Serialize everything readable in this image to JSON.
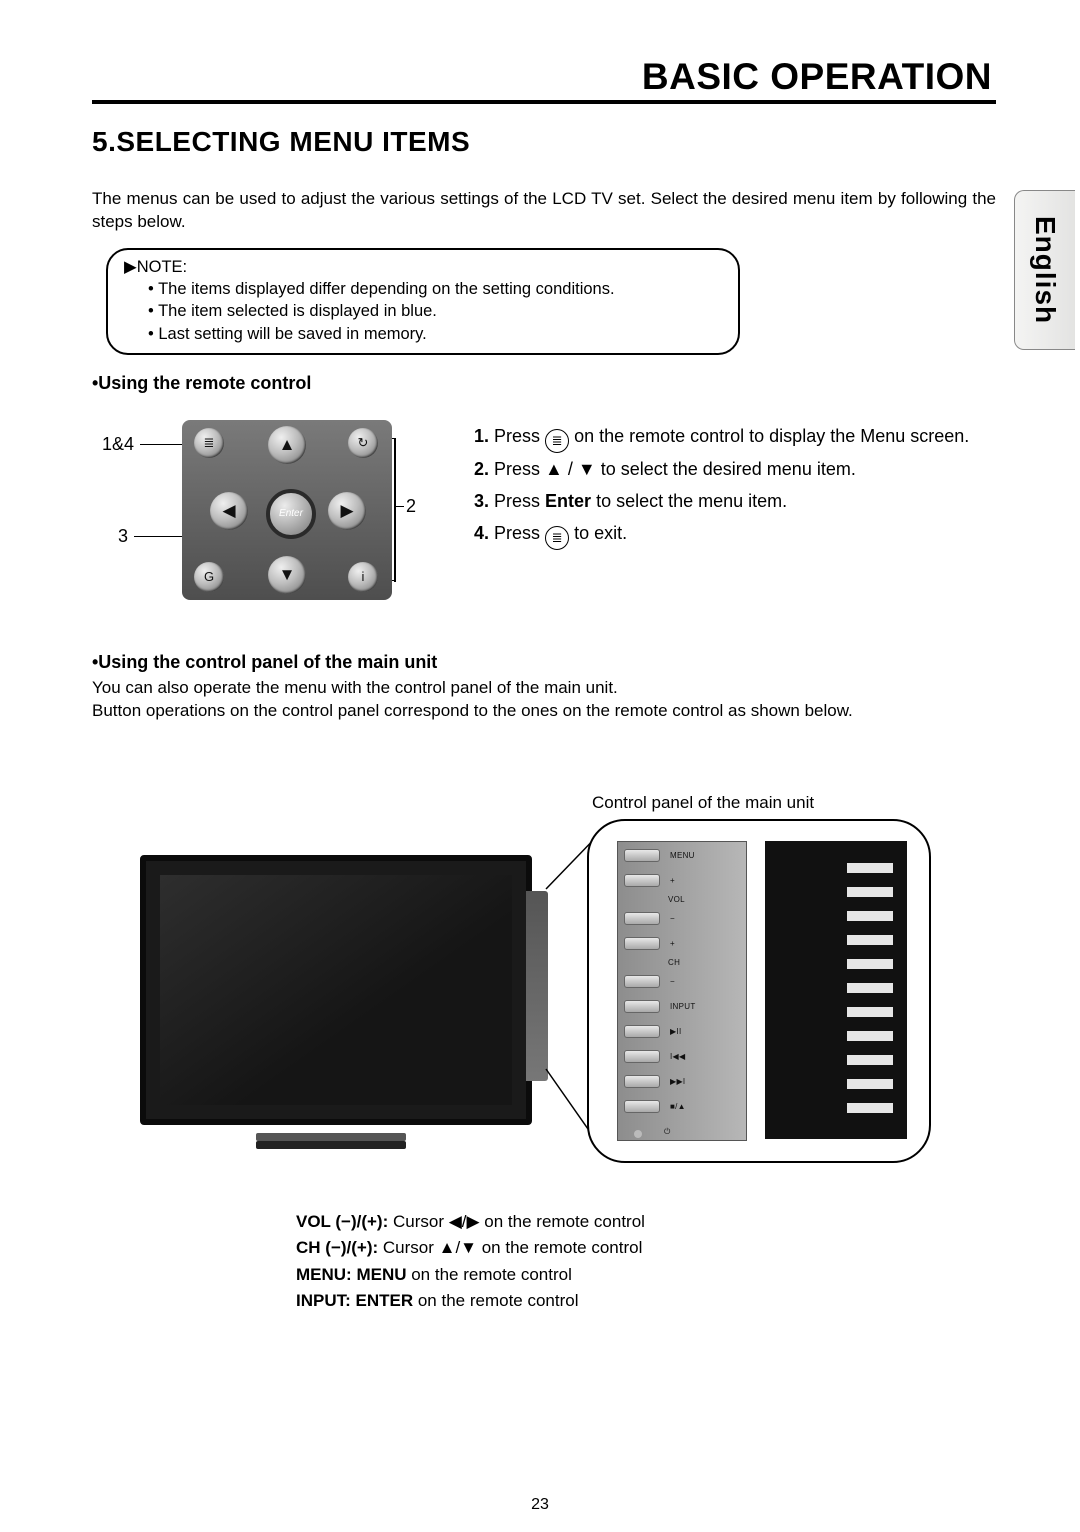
{
  "header": {
    "chapter_title": "BASIC OPERATION"
  },
  "language_tab": "English",
  "section": {
    "number_title": "5.SELECTING MENU ITEMS",
    "intro": "The menus can be used to adjust the various settings of the LCD TV set. Select the desired menu item by following the steps below."
  },
  "note": {
    "label": "▶NOTE:",
    "items": [
      "The items displayed differ depending on the setting conditions.",
      "The item selected is displayed in blue.",
      "Last setting will be saved in memory."
    ]
  },
  "remote_section": {
    "heading": "•Using the remote control",
    "callouts": {
      "left_top": "1&4",
      "left_bottom": "3",
      "right": "2"
    },
    "center_label": "Enter",
    "steps": [
      {
        "n": "1.",
        "pre": "Press ",
        "icon": "menu",
        "post": " on the remote control to display the Menu screen."
      },
      {
        "n": "2.",
        "pre": "Press ",
        "glyphs": "▲ / ▼",
        "post": " to select the desired menu item."
      },
      {
        "n": "3.",
        "pre": "Press ",
        "bold": "Enter",
        "post": " to select the menu item."
      },
      {
        "n": "4.",
        "pre": "Press ",
        "icon": "menu",
        "post": " to exit."
      }
    ]
  },
  "control_panel_section": {
    "heading": "•Using the control panel of the main unit",
    "desc_line1": "You can also operate the menu with the control panel of the main unit.",
    "desc_line2": "Button operations on the control panel correspond to the ones on the remote control as shown below.",
    "caption": "Control panel of the main unit",
    "panel_labels": [
      "MENU",
      "+",
      "VOL",
      "−",
      "+",
      "CH",
      "−",
      "INPUT",
      "▶II",
      "I◀◀",
      "▶▶I",
      "■/▲",
      "⏻"
    ]
  },
  "mapping": {
    "lines": [
      {
        "b": "VOL (−)/(+):",
        "t": " Cursor ◀/▶ on the remote control"
      },
      {
        "b": "CH (−)/(+):",
        "t": " Cursor ▲/▼ on the remote control"
      },
      {
        "b": "MENU: MENU",
        "t": " on the remote control"
      },
      {
        "b": "INPUT: ENTER",
        "t": " on the remote control"
      }
    ]
  },
  "page_number": "23"
}
